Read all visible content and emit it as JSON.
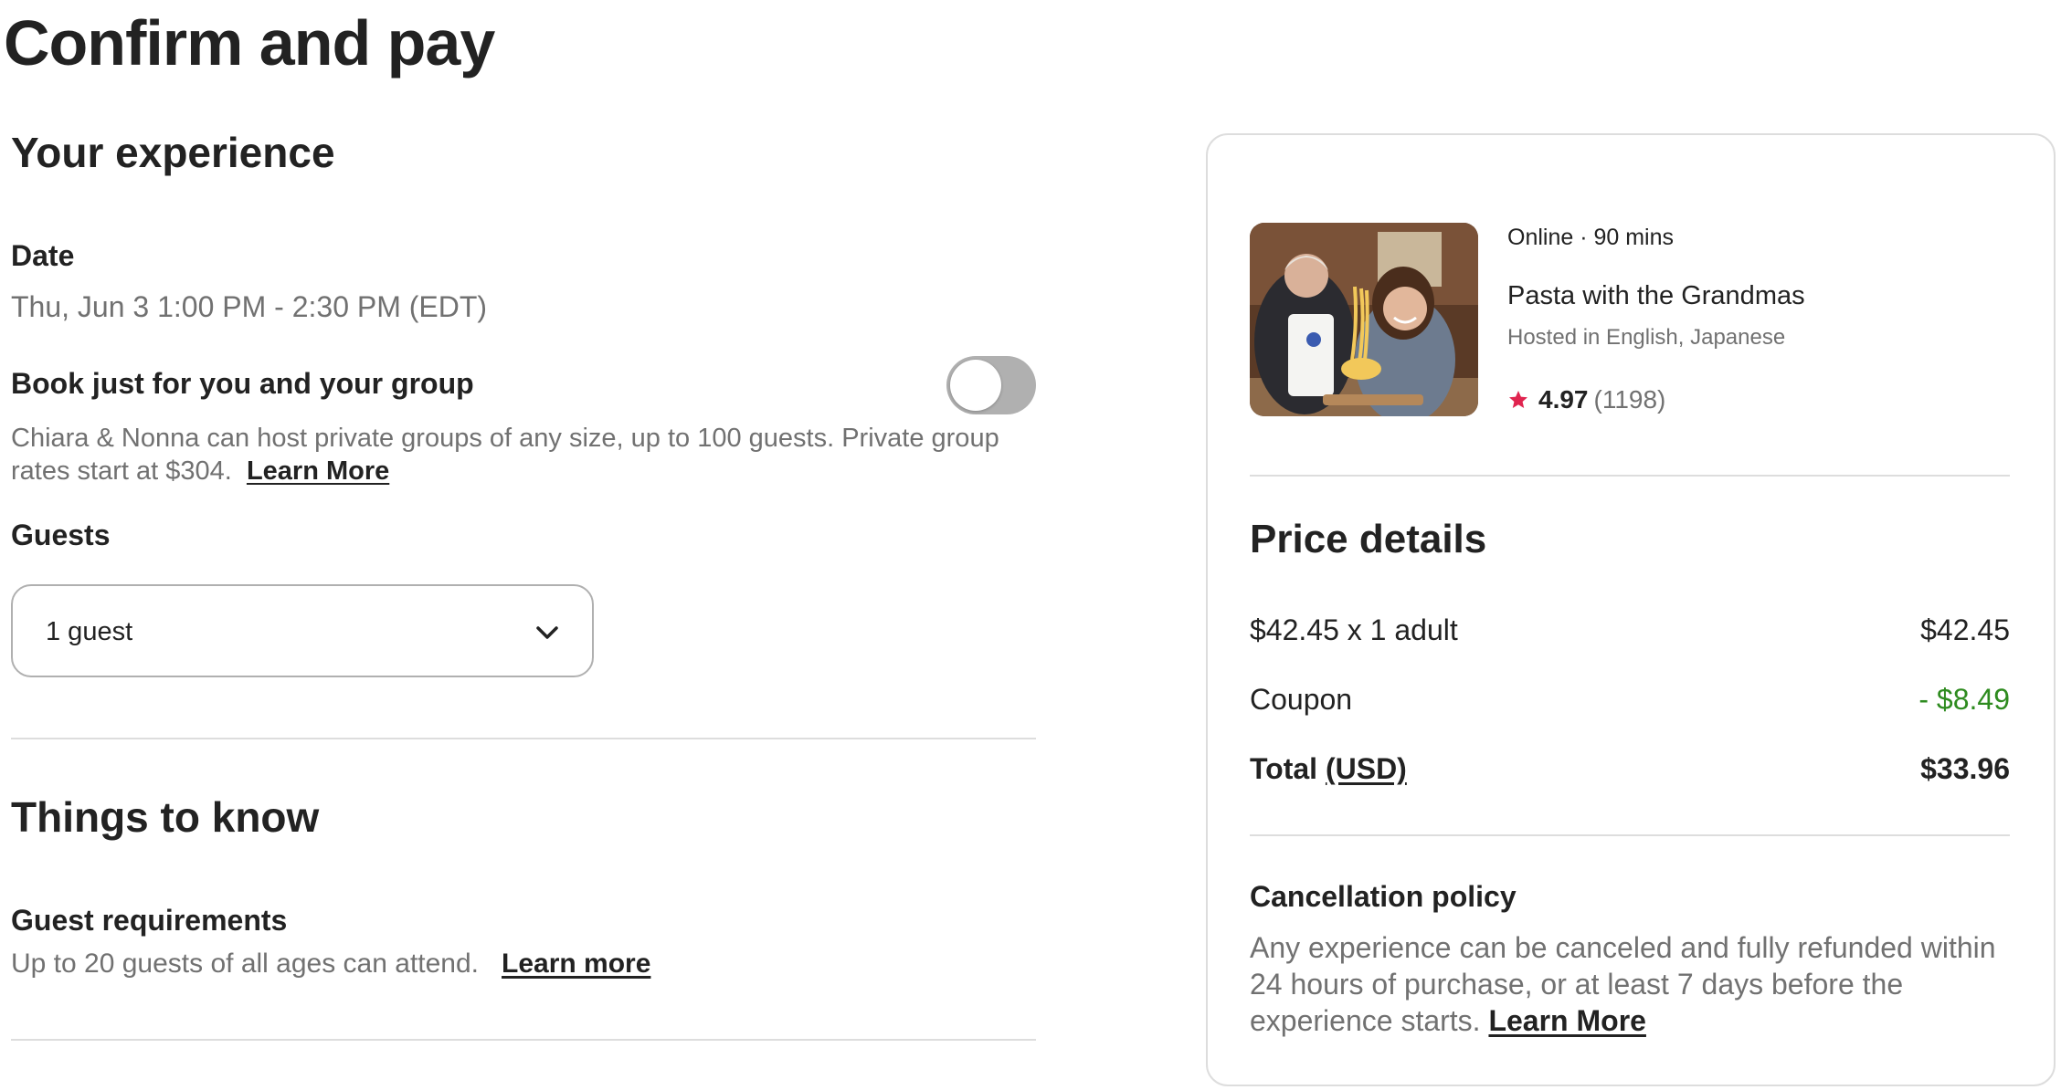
{
  "page": {
    "title": "Confirm and pay"
  },
  "experience": {
    "heading": "Your experience",
    "date_label": "Date",
    "date_value": "Thu, Jun 3 1:00 PM - 2:30 PM (EDT)",
    "private_group_label": "Book just for you and your group",
    "private_group_enabled": false,
    "private_group_text": "Chiara & Nonna can host private groups of any size, up to 100 guests. Private group rates start at $304.",
    "private_group_link": "Learn More",
    "guests_label": "Guests",
    "guests_value": "1 guest"
  },
  "things_to_know": {
    "heading": "Things to know",
    "requirements_label": "Guest requirements",
    "requirements_text": "Up to 20 guests of all ages can attend.",
    "requirements_link": "Learn more"
  },
  "listing": {
    "meta": "Online · 90 mins",
    "title": "Pasta with the Grandmas",
    "languages": "Hosted in English, Japanese",
    "rating": "4.97",
    "reviews": "(1198)"
  },
  "price": {
    "heading": "Price details",
    "rows": [
      {
        "label": "$42.45 x 1 adult",
        "value": "$42.45"
      },
      {
        "label": "Coupon",
        "value": "- $8.49"
      }
    ],
    "total_label": "Total",
    "total_currency": "(USD)",
    "total_value": "$33.96"
  },
  "cancellation": {
    "heading": "Cancellation policy",
    "text": "Any experience can be canceled and fully refunded within 24 hours of purchase, or at least 7 days before the experience starts.",
    "link": "Learn More"
  },
  "colors": {
    "text": "#222222",
    "muted": "#717171",
    "divider": "#dddddd",
    "discount": "#2e8b1f",
    "star": "#e0244f",
    "toggle_off": "#b0b0b0"
  },
  "icons": [
    "chevron-down-icon",
    "star-icon"
  ]
}
